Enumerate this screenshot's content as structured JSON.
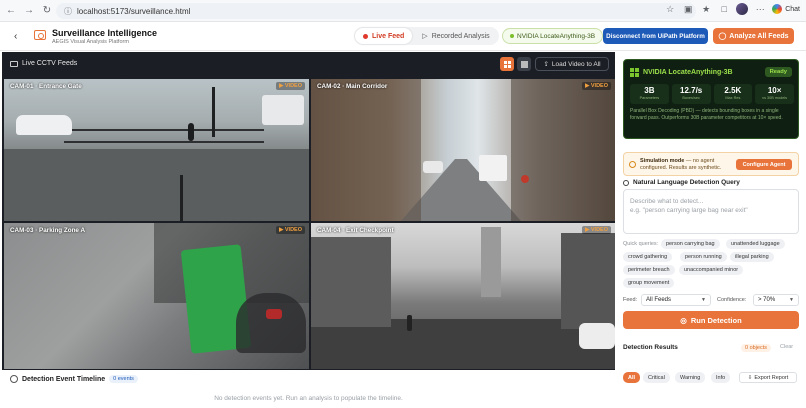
{
  "browser": {
    "url": "localhost:5173/surveillance.html",
    "chat_label": "Chat"
  },
  "header": {
    "title": "Surveillance Intelligence",
    "subtitle": "AEGIS Visual Analysis Platform",
    "tabs": [
      {
        "label": "Live Feed",
        "active": true
      },
      {
        "label": "Recorded Analysis",
        "active": false
      }
    ],
    "model_pill": "NVIDIA LocateAnything-3B",
    "disconnect_label": "Disconnect from UiPath Platform",
    "analyze_label": "Analyze All Feeds"
  },
  "video": {
    "section_label": "Live CCTV Feeds",
    "load_label": "Load Video to All",
    "cameras": [
      {
        "label": "CAM-01 · Entrance Gate",
        "badge": "▶ VIDEO"
      },
      {
        "label": "CAM-02 · Main Corridor",
        "badge": "▶ VIDEO"
      },
      {
        "label": "CAM-03 · Parking Zone A",
        "badge": "▶ VIDEO"
      },
      {
        "label": "CAM-04 · Exit Checkpoint",
        "badge": "▶ VIDEO"
      }
    ]
  },
  "timeline": {
    "title": "Detection Event Timeline",
    "count": "0 events",
    "empty": "No detection events yet. Run an analysis to populate the timeline."
  },
  "model_card": {
    "title": "NVIDIA LocateAnything-3B",
    "status": "Ready",
    "stats": [
      {
        "value": "3B",
        "key": "Parameters"
      },
      {
        "value": "12.7/s",
        "key": "Boxes/sec"
      },
      {
        "value": "2.5K",
        "key": "Max Res"
      },
      {
        "value": "10×",
        "key": "vs 30B models"
      }
    ],
    "description": "Parallel Box Decoding (PBD) — detects bounding boxes in a single forward pass. Outperforms 30B parameter competitors at 10× speed."
  },
  "simulation": {
    "title": "Simulation mode",
    "text": " — no agent configured. Results are synthetic.",
    "configure_label": "Configure Agent"
  },
  "query": {
    "title": "Natural Language Detection Query",
    "placeholder_line1": "Describe what to detect...",
    "placeholder_line2": "e.g. \"person carrying large bag near exit\"",
    "quick_label": "Quick queries:",
    "chips": [
      "person carrying bag",
      "unattended luggage",
      "crowd gathering",
      "person running",
      "illegal parking",
      "perimeter breach",
      "unaccompanied minor",
      "group movement"
    ],
    "feed_label": "Feed:",
    "feed_value": "All Feeds",
    "confidence_label": "Confidence:",
    "confidence_value": "> 70%",
    "run_label": "Run Detection"
  },
  "results": {
    "title": "Detection Results",
    "count": "0 objects",
    "clear_label": "Clear",
    "filters": [
      {
        "label": "All",
        "active": true
      },
      {
        "label": "Critical",
        "active": false
      },
      {
        "label": "Warning",
        "active": false
      },
      {
        "label": "Info",
        "active": false
      }
    ],
    "export_label": "Export Report"
  },
  "colors": {
    "accent": "#e8743b",
    "primary_blue": "#1e5bb8",
    "live_red": "#d23b22",
    "model_green": "#9be04a"
  }
}
